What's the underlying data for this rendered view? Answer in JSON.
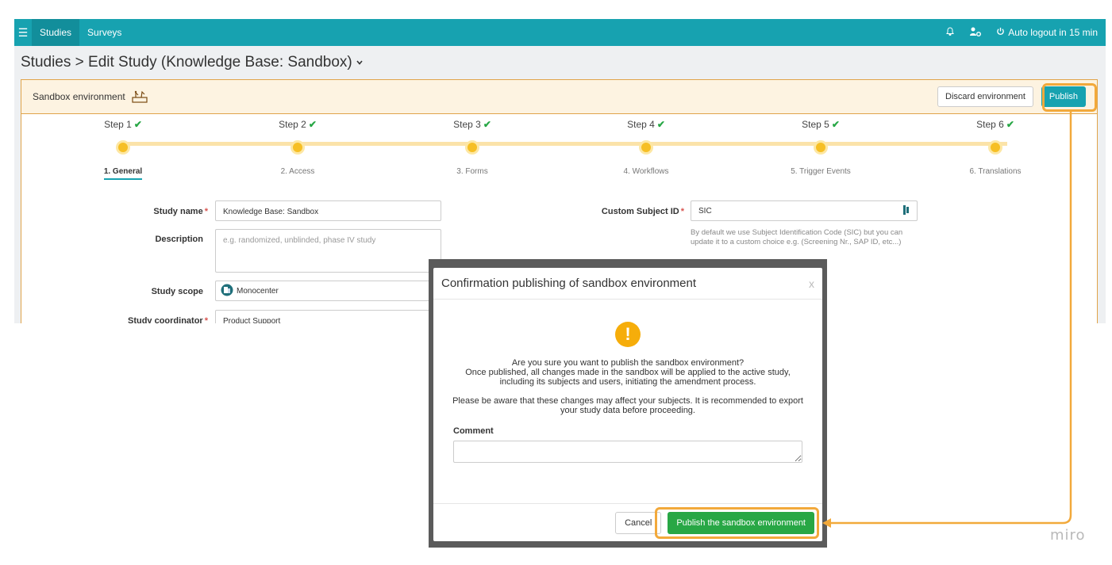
{
  "topbar": {
    "menu_icon": "menu-icon",
    "nav": [
      {
        "label": "Studies",
        "active": true
      },
      {
        "label": "Surveys",
        "active": false
      }
    ],
    "bell_icon": "bell-icon",
    "user_icon": "user-settings-icon",
    "logout_icon": "power-icon",
    "logout_text": "Auto logout in 15 min"
  },
  "breadcrumb": {
    "text": "Studies > Edit Study (Knowledge Base: Sandbox)",
    "chevron_icon": "chevron-down-icon"
  },
  "sandbox": {
    "label": "Sandbox environment",
    "icon": "sandbox-icon",
    "discard_label": "Discard environment",
    "publish_label": "Publish"
  },
  "steps": [
    {
      "title": "Step 1",
      "label": "1. General",
      "done": true,
      "active": true
    },
    {
      "title": "Step 2",
      "label": "2. Access",
      "done": true,
      "active": false
    },
    {
      "title": "Step 3",
      "label": "3. Forms",
      "done": true,
      "active": false
    },
    {
      "title": "Step 4",
      "label": "4. Workflows",
      "done": true,
      "active": false
    },
    {
      "title": "Step 5",
      "label": "5. Trigger Events",
      "done": true,
      "active": false
    },
    {
      "title": "Step 6",
      "label": "6. Translations",
      "done": true,
      "active": false
    }
  ],
  "form": {
    "study_name_label": "Study name",
    "study_name_value": "Knowledge Base: Sandbox",
    "description_label": "Description",
    "description_placeholder": "e.g. randomized, unblinded, phase IV study",
    "study_scope_label": "Study scope",
    "study_scope_value": "Monocenter",
    "study_coordinator_label": "Study coordinator",
    "study_coordinator_value": "Product Support",
    "custom_subject_label": "Custom Subject ID",
    "custom_subject_value": "SIC",
    "custom_subject_help": "By default we use Subject Identification Code (SIC) but you can update it to a custom choice e.g. (Screening Nr., SAP ID, etc...)"
  },
  "modal": {
    "title": "Confirmation publishing of sandbox environment",
    "close": "x",
    "warning_icon": "exclamation-icon",
    "line1": "Are you sure you want to publish the sandbox environment?",
    "line2": "Once published, all changes made in the sandbox will be applied to the active study, including its subjects and users, initiating the amendment process.",
    "line3": "Please be aware that these changes may affect your subjects. It is recommended to export your study data before proceeding.",
    "comment_label": "Comment",
    "cancel_label": "Cancel",
    "confirm_label": "Publish the sandbox environment"
  },
  "brand": "miro",
  "colors": {
    "primary": "#17a2b0",
    "sandbox_border": "#e0a44a",
    "highlight": "#f2a93b",
    "confirm": "#28a745",
    "step_dot": "#f6bf25"
  }
}
